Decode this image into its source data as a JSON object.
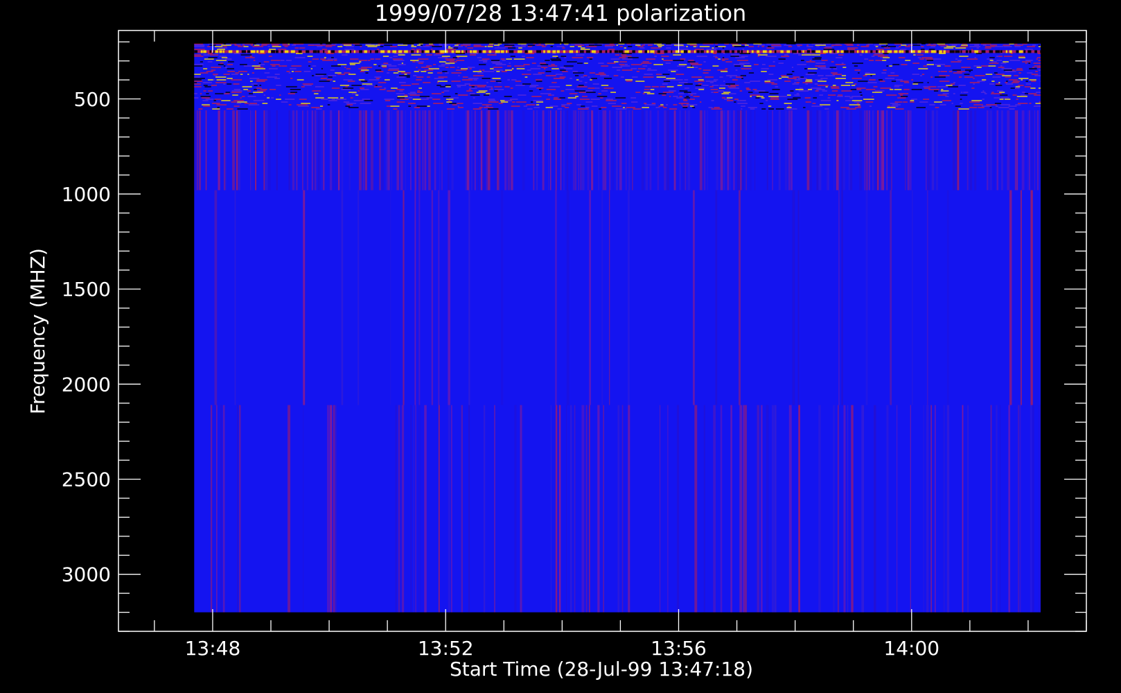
{
  "chart_data": {
    "type": "heatmap",
    "title": "1999/07/28 13:47:41 polarization",
    "xlabel": "Start Time (28-Jul-99 13:47:18)",
    "ylabel": "Frequency (MHZ)",
    "xlim": [
      "13:46:23",
      "14:03:00"
    ],
    "ylim": [
      3300,
      140
    ],
    "data_x_range": [
      "13:47:41",
      "14:02:29"
    ],
    "data_y_range": [
      200,
      3200
    ],
    "x_ticks": [
      "13:48",
      "13:52",
      "13:56",
      "14:00"
    ],
    "y_ticks": [
      500,
      1000,
      1500,
      2000,
      2500,
      3000
    ],
    "bands": [
      {
        "from": 200,
        "to": 560,
        "appearance": "dense red/yellow/blue striped noise"
      },
      {
        "from": 560,
        "to": 980,
        "appearance": "blue with frequent red vertical stripes"
      },
      {
        "from": 980,
        "to": 2110,
        "appearance": "mostly blue with faint stripes"
      },
      {
        "from": 2110,
        "to": 3200,
        "appearance": "blue with moderate purple/red vertical stripes"
      }
    ],
    "colors": {
      "background": "#000000",
      "axes": "#ffffff",
      "base": "#1414f0",
      "stripe": "#c81e46",
      "hot": "#ffe600"
    }
  }
}
